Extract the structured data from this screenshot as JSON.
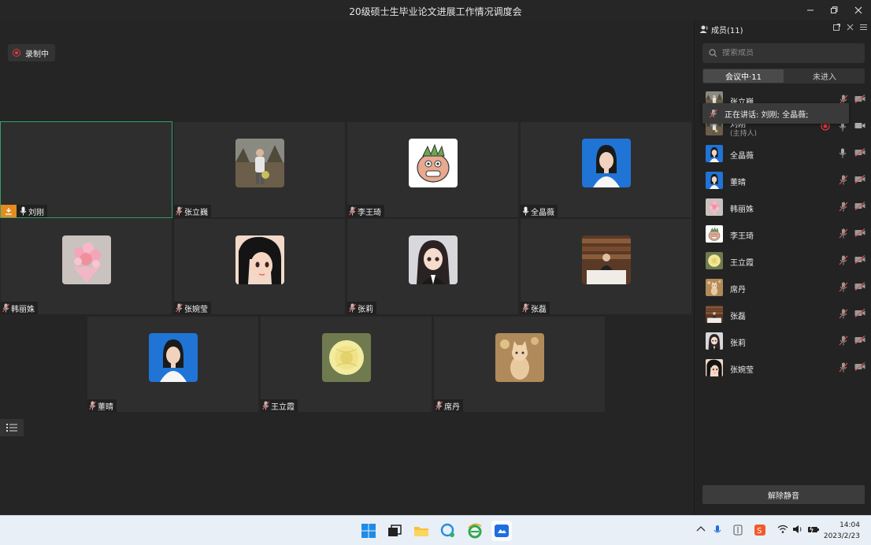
{
  "window": {
    "title": "20级硕士生毕业论文进展工作情况调度会"
  },
  "recording": {
    "label": "录制中"
  },
  "tiles": [
    {
      "name": "刘刚",
      "mic": "on",
      "host": true,
      "avatar": "none",
      "active": true
    },
    {
      "name": "张立巍",
      "mic": "muted",
      "avatar": "person-outdoor"
    },
    {
      "name": "李王琦",
      "mic": "muted",
      "avatar": "cartoon-monster"
    },
    {
      "name": "全晶薇",
      "mic": "on",
      "avatar": "portrait-blue"
    },
    {
      "name": "韩丽姝",
      "mic": "muted",
      "avatar": "flower-bouquet"
    },
    {
      "name": "张婉莹",
      "mic": "muted",
      "avatar": "anime-girl"
    },
    {
      "name": "张莉",
      "mic": "muted",
      "avatar": "doll-girl"
    },
    {
      "name": "张磊",
      "mic": "muted",
      "avatar": "person-library"
    },
    {
      "name": "董晴",
      "mic": "muted",
      "avatar": "portrait-blue"
    },
    {
      "name": "王立霞",
      "mic": "muted",
      "avatar": "yellow-rose"
    },
    {
      "name": "席丹",
      "mic": "muted",
      "avatar": "cat"
    }
  ],
  "panel": {
    "title": "成员(11)",
    "search_placeholder": "搜索成员",
    "tabs": [
      {
        "label": "会议中·11"
      },
      {
        "label": "未进入"
      }
    ],
    "speaking_tooltip": "正在讲话: 刘刚; 全晶薇;",
    "members": [
      {
        "name": "张立巍",
        "role": "",
        "mic": "muted",
        "cam": "off",
        "avatar": "person-outdoor"
      },
      {
        "name": "刘刚",
        "role": "(主持人)",
        "mic": "on",
        "cam": "on",
        "recording": true,
        "avatar": "person-outdoor"
      },
      {
        "name": "全晶薇",
        "role": "",
        "mic": "on",
        "cam": "off",
        "avatar": "portrait-blue"
      },
      {
        "name": "董晴",
        "role": "",
        "mic": "muted",
        "cam": "off",
        "avatar": "portrait-blue"
      },
      {
        "name": "韩丽姝",
        "role": "",
        "mic": "muted",
        "cam": "off",
        "avatar": "flower-bouquet"
      },
      {
        "name": "李王琦",
        "role": "",
        "mic": "muted",
        "cam": "off",
        "avatar": "cartoon-monster"
      },
      {
        "name": "王立霞",
        "role": "",
        "mic": "muted",
        "cam": "off",
        "avatar": "yellow-rose"
      },
      {
        "name": "席丹",
        "role": "",
        "mic": "muted",
        "cam": "off",
        "avatar": "cat"
      },
      {
        "name": "张磊",
        "role": "",
        "mic": "muted",
        "cam": "off",
        "avatar": "person-library"
      },
      {
        "name": "张莉",
        "role": "",
        "mic": "muted",
        "cam": "off",
        "avatar": "doll-girl"
      },
      {
        "name": "张婉莹",
        "role": "",
        "mic": "muted",
        "cam": "off",
        "avatar": "anime-girl"
      }
    ],
    "unmute_label": "解除静音"
  },
  "taskbar": {
    "time": "14:04",
    "date": "2023/2/23"
  },
  "colors": {
    "accent_green": "#2fa36b",
    "host_orange": "#e58a1f",
    "record_red": "#e03b3b"
  }
}
